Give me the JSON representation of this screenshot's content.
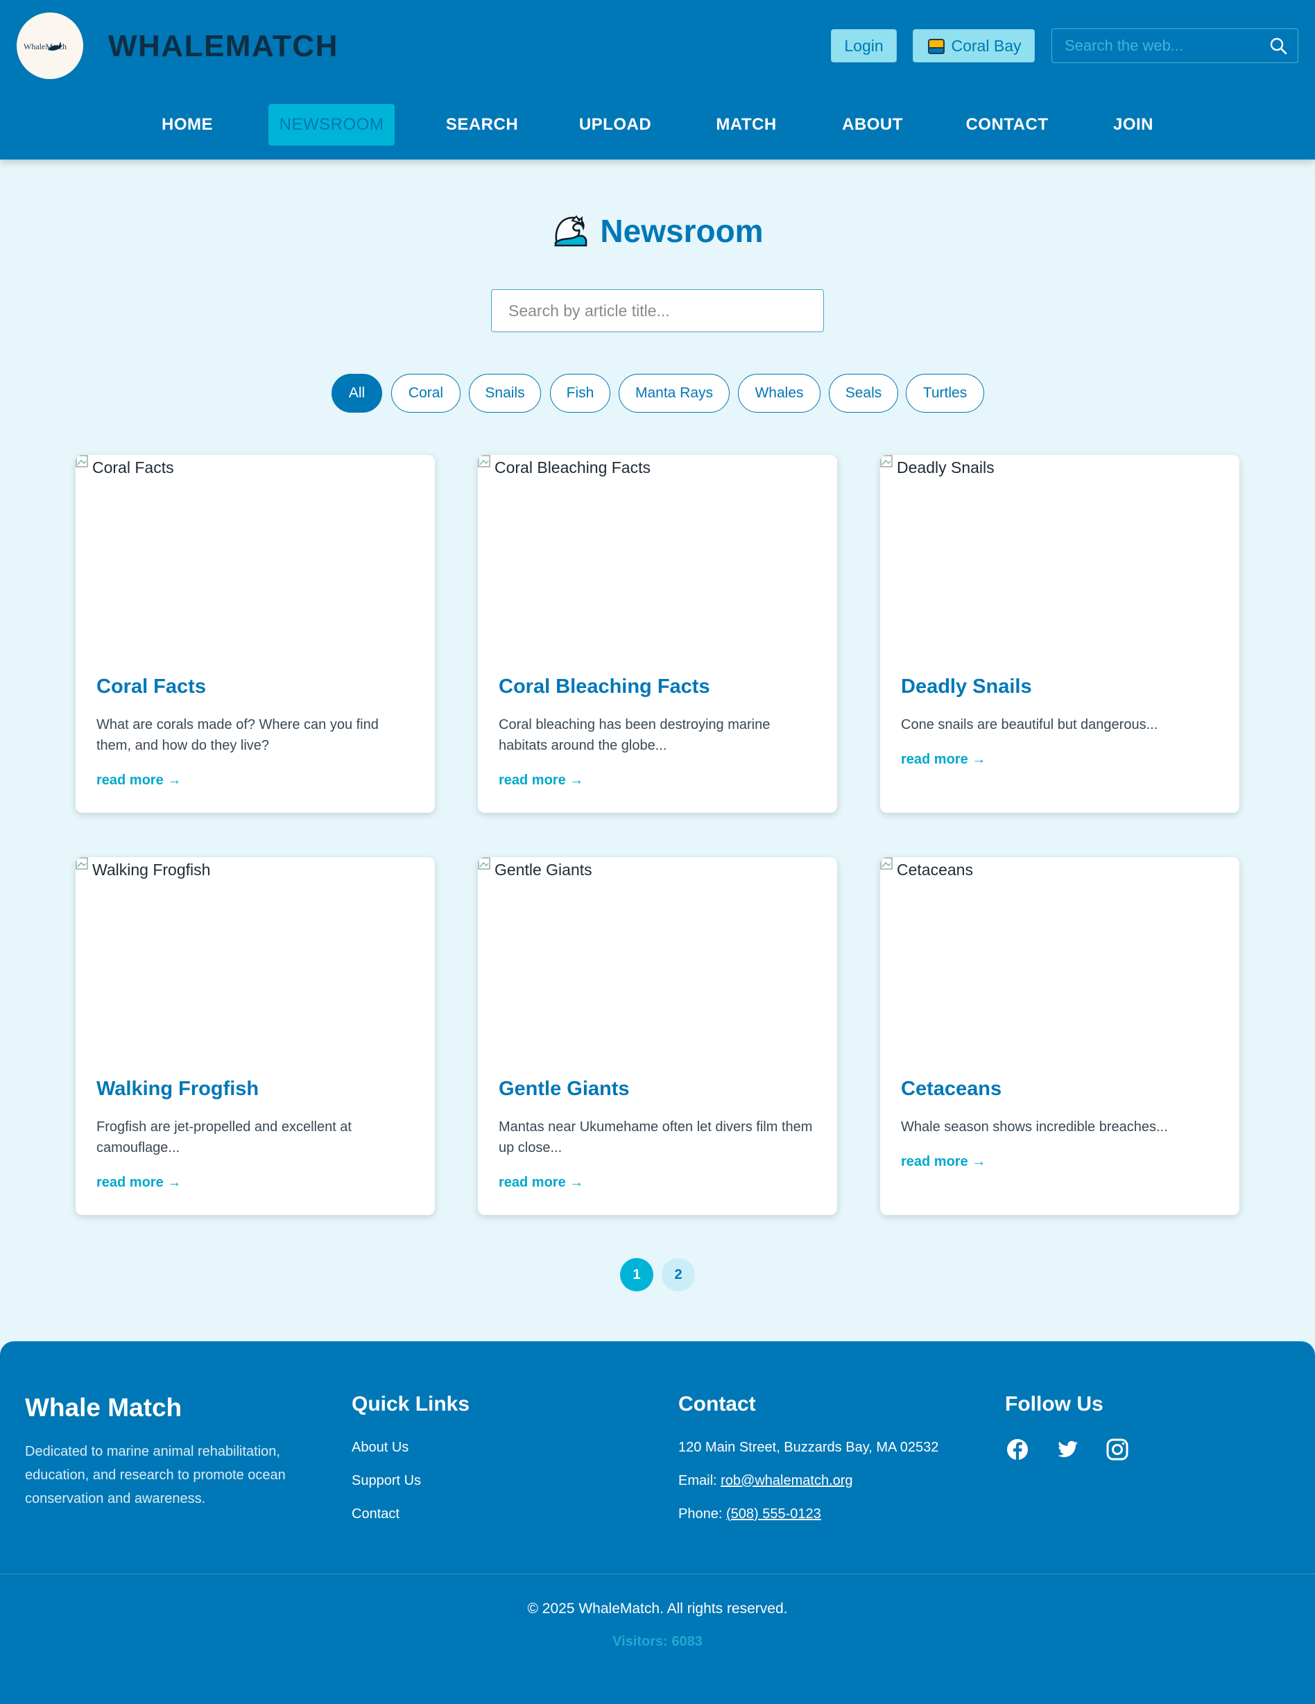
{
  "header": {
    "logo_text": "WhaleMatch",
    "brand": "WHALEMATCH",
    "login_label": "Login",
    "location_label": "Coral Bay",
    "search_placeholder": "Search the web..."
  },
  "nav": {
    "items": [
      {
        "label": "HOME"
      },
      {
        "label": "NEWSROOM",
        "active": true
      },
      {
        "label": "SEARCH"
      },
      {
        "label": "UPLOAD"
      },
      {
        "label": "MATCH"
      },
      {
        "label": "ABOUT"
      },
      {
        "label": "CONTACT"
      },
      {
        "label": "JOIN"
      }
    ]
  },
  "newsroom": {
    "title": "Newsroom",
    "title_icon": "wave-icon",
    "search_placeholder": "Search by article title..."
  },
  "filters": [
    "All",
    "Coral",
    "Snails",
    "Fish",
    "Manta Rays",
    "Whales",
    "Seals",
    "Turtles"
  ],
  "active_filter": "All",
  "articles": [
    {
      "image_alt": "Coral Facts",
      "title": "Coral Facts",
      "desc": "What are corals made of? Where can you find them, and how do they live?",
      "link": "read more →"
    },
    {
      "image_alt": "Coral Bleaching Facts",
      "title": "Coral Bleaching Facts",
      "desc": "Coral bleaching has been destroying marine habitats around the globe...",
      "link": "read more →"
    },
    {
      "image_alt": "Deadly Snails",
      "title": "Deadly Snails",
      "desc": "Cone snails are beautiful but dangerous...",
      "link": "read more →"
    },
    {
      "image_alt": "Walking Frogfish",
      "title": "Walking Frogfish",
      "desc": "Frogfish are jet-propelled and excellent at camouflage...",
      "link": "read more →"
    },
    {
      "image_alt": "Gentle Giants",
      "title": "Gentle Giants",
      "desc": "Mantas near Ukumehame often let divers film them up close...",
      "link": "read more →"
    },
    {
      "image_alt": "Cetaceans",
      "title": "Cetaceans",
      "desc": "Whale season shows incredible breaches...",
      "link": "read more →"
    }
  ],
  "pagination": {
    "pages": [
      "1",
      "2"
    ],
    "current": "1"
  },
  "footer": {
    "brand": "Whale Match",
    "description": "Dedicated to marine animal rehabilitation, education, and research to promote ocean conservation and awareness.",
    "quick_links_title": "Quick Links",
    "quick_links": [
      "About Us",
      "Support Us",
      "Contact"
    ],
    "contact_title": "Contact",
    "address": "120 Main Street, Buzzards Bay, MA 02532",
    "email_label": "Email:",
    "email": "rob@whalematch.org",
    "phone_label": "Phone:",
    "phone": "(508) 555-0123",
    "follow_title": "Follow Us",
    "social": [
      "facebook-icon",
      "twitter-icon",
      "instagram-icon"
    ],
    "copyright": "© 2025 WhaleMatch. All rights reserved.",
    "visitors": "Visitors: 6083"
  },
  "colors": {
    "primary": "#0077b6",
    "accent": "#00b4d8",
    "light_accent": "#90e0ef",
    "page_bg": "#e6f6fa",
    "brand_text": "#0d2e45"
  }
}
